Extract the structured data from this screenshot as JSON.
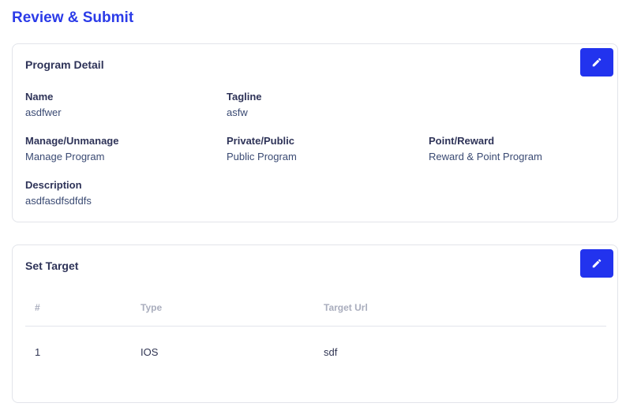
{
  "page": {
    "title": "Review & Submit"
  },
  "program_detail": {
    "title": "Program Detail",
    "edit_icon": "pencil-icon",
    "fields": {
      "name": {
        "label": "Name",
        "value": "asdfwer"
      },
      "tagline": {
        "label": "Tagline",
        "value": "asfw"
      },
      "manage": {
        "label": "Manage/Unmanage",
        "value": "Manage Program"
      },
      "privacy": {
        "label": "Private/Public",
        "value": "Public Program"
      },
      "reward": {
        "label": "Point/Reward",
        "value": "Reward & Point Program"
      },
      "description": {
        "label": "Description",
        "value": "asdfasdfsdfdfs"
      }
    }
  },
  "set_target": {
    "title": "Set Target",
    "edit_icon": "pencil-icon",
    "columns": [
      "#",
      "Type",
      "Target Url"
    ],
    "rows": [
      [
        "1",
        "IOS",
        "sdf"
      ]
    ]
  },
  "colors": {
    "accent": "#2233ee",
    "title": "#2b3be8",
    "border": "#e2e4ea"
  }
}
